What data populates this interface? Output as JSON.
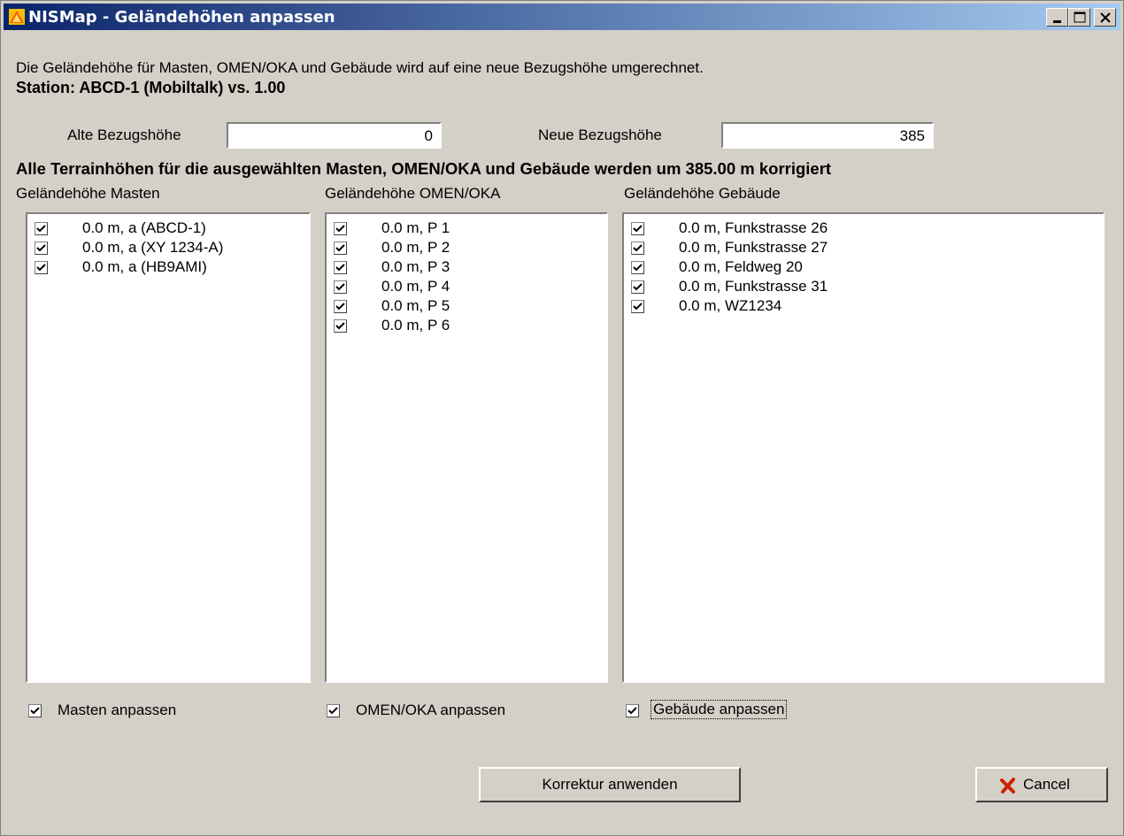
{
  "window": {
    "title": "NISMap - Geländehöhen anpassen"
  },
  "description": "Die Geländehöhe für Masten, OMEN/OKA und Gebäude wird auf eine neue Bezugshöhe umgerechnet.",
  "station": "Station: ABCD-1 (Mobiltalk) vs. 1.00",
  "old_ref": {
    "label": "Alte Bezugshöhe",
    "value": "0"
  },
  "new_ref": {
    "label": "Neue Bezugshöhe",
    "value": "385"
  },
  "summary": "Alle Terrainhöhen für die ausgewählten Masten, OMEN/OKA und Gebäude werden um 385.00 m korrigiert",
  "masts": {
    "heading": "Geländehöhe Masten",
    "items": [
      {
        "value": "0.0 m,",
        "name": "a (ABCD-1)",
        "checked": true
      },
      {
        "value": "0.0 m,",
        "name": "a (XY 1234-A)",
        "checked": true
      },
      {
        "value": "0.0 m,",
        "name": "a (HB9AMI)",
        "checked": true
      }
    ],
    "adjust_label": "Masten anpassen"
  },
  "omen": {
    "heading": "Geländehöhe OMEN/OKA",
    "items": [
      {
        "value": "0.0 m,",
        "name": "P 1",
        "checked": true
      },
      {
        "value": "0.0 m,",
        "name": "P 2",
        "checked": true
      },
      {
        "value": "0.0 m,",
        "name": "P 3",
        "checked": true
      },
      {
        "value": "0.0 m,",
        "name": "P 4",
        "checked": true
      },
      {
        "value": "0.0 m,",
        "name": "P 5",
        "checked": true
      },
      {
        "value": "0.0 m,",
        "name": "P 6",
        "checked": true
      }
    ],
    "adjust_label": "OMEN/OKA anpassen"
  },
  "buildings": {
    "heading": "Geländehöhe Gebäude",
    "items": [
      {
        "value": "0.0 m,",
        "name": "Funkstrasse 26",
        "checked": true
      },
      {
        "value": "0.0 m,",
        "name": "Funkstrasse 27",
        "checked": true
      },
      {
        "value": "0.0 m,",
        "name": "Feldweg 20",
        "checked": true
      },
      {
        "value": "0.0 m,",
        "name": "Funkstrasse 31",
        "checked": true
      },
      {
        "value": "0.0 m,",
        "name": "WZ1234",
        "checked": true
      }
    ],
    "adjust_label": "Gebäude anpassen"
  },
  "buttons": {
    "apply": "Korrektur anwenden",
    "cancel": "Cancel"
  },
  "colors": {
    "titlebar_start": "#0a246a",
    "titlebar_end": "#a6caf0",
    "face": "#d4d0c8",
    "cancel_icon": "#cc2200"
  }
}
